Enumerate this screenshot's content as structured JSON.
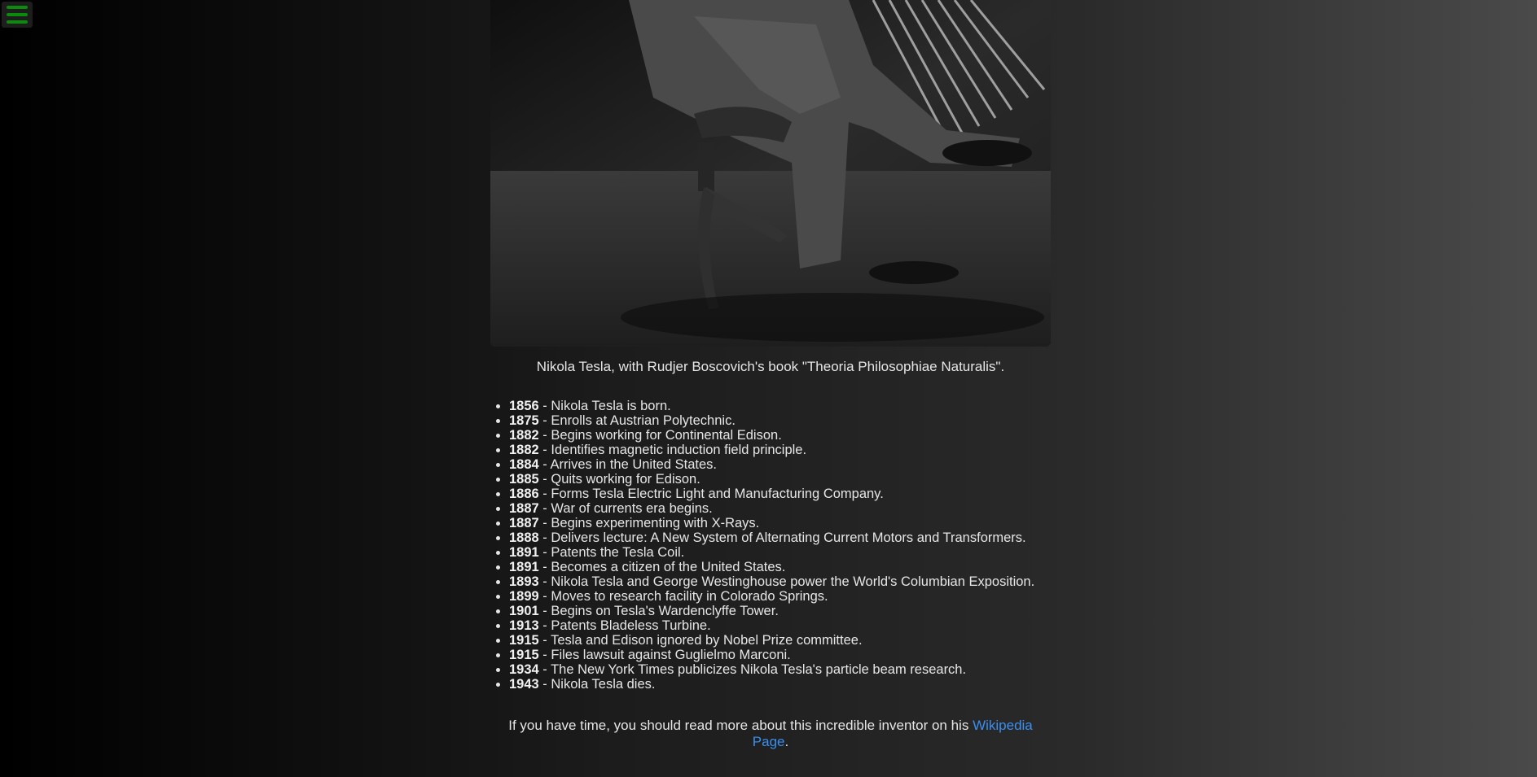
{
  "nav": {
    "menu_icon": "hamburger-menu-icon",
    "menu_color": "#0b8a0b"
  },
  "photo": {
    "alt": "Nikola Tesla, with Rudjer Boscovich's book"
  },
  "caption": "Nikola Tesla, with Rudjer Boscovich's book \"Theoria Philosophiae Naturalis\".",
  "timeline": [
    {
      "year": "1856",
      "text": " - Nikola Tesla is born."
    },
    {
      "year": "1875",
      "text": " - Enrolls at Austrian Polytechnic."
    },
    {
      "year": "1882",
      "text": " - Begins working for Continental Edison."
    },
    {
      "year": "1882",
      "text": " - Identifies magnetic induction field principle."
    },
    {
      "year": "1884",
      "text": " - Arrives in the United States."
    },
    {
      "year": "1885",
      "text": " - Quits working for Edison."
    },
    {
      "year": "1886",
      "text": " - Forms Tesla Electric Light and Manufacturing Company."
    },
    {
      "year": "1887",
      "text": " - War of currents era begins."
    },
    {
      "year": "1887",
      "text": " - Begins experimenting with X-Rays."
    },
    {
      "year": "1888",
      "text": " - Delivers lecture: A New System of Alternating Current Motors and Transformers."
    },
    {
      "year": "1891",
      "text": " - Patents the Tesla Coil."
    },
    {
      "year": "1891",
      "text": " - Becomes a citizen of the United States."
    },
    {
      "year": "1893",
      "text": " - Nikola Tesla and George Westinghouse power the World's Columbian Exposition."
    },
    {
      "year": "1899",
      "text": " - Moves to research facility in Colorado Springs."
    },
    {
      "year": "1901",
      "text": " - Begins on Tesla's Wardenclyffe Tower."
    },
    {
      "year": "1913",
      "text": " - Patents Bladeless Turbine."
    },
    {
      "year": "1915",
      "text": " - Tesla and Edison ignored by Nobel Prize committee."
    },
    {
      "year": "1915",
      "text": " - Files lawsuit against Guglielmo Marconi."
    },
    {
      "year": "1934",
      "text": " - The New York Times publicizes Nikola Tesla's particle beam research."
    },
    {
      "year": "1943",
      "text": " - Nikola Tesla dies."
    }
  ],
  "footer": {
    "prefix": "If you have time, you should read more about this incredible inventor on his ",
    "link_text": "Wikipedia Page",
    "suffix": ".",
    "link_color": "#3b8ff0"
  }
}
